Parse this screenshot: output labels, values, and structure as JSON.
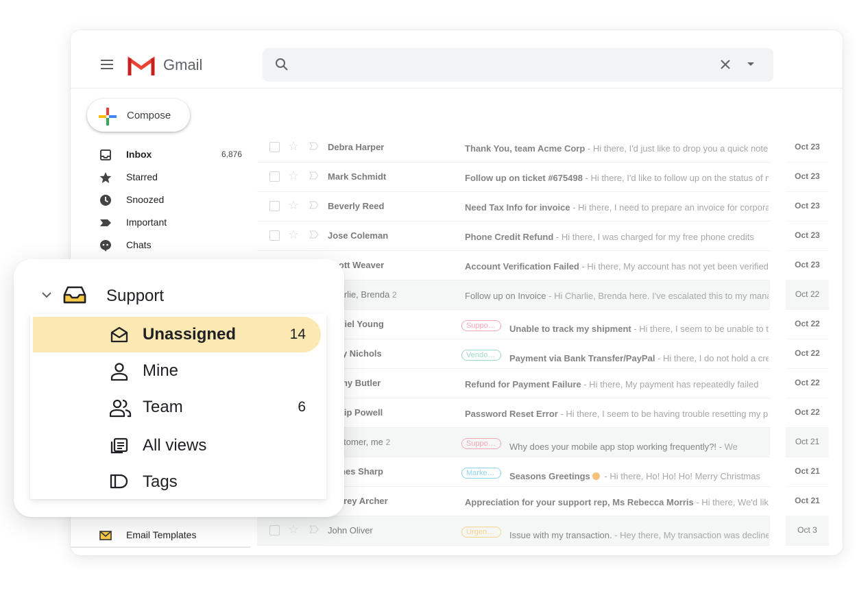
{
  "app": {
    "brand": "Gmail"
  },
  "compose": {
    "label": "Compose"
  },
  "sidebar": {
    "items": [
      {
        "label": "Inbox",
        "count": "6,876",
        "icon": "inbox-icon"
      },
      {
        "label": "Starred",
        "count": "",
        "icon": "star-icon"
      },
      {
        "label": "Snoozed",
        "count": "",
        "icon": "clock-icon"
      },
      {
        "label": "Important",
        "count": "",
        "icon": "important-icon"
      },
      {
        "label": "Chats",
        "count": "",
        "icon": "chat-icon"
      }
    ],
    "templates_label": "Email Templates"
  },
  "emails": [
    {
      "sender": "Debra Harper",
      "count": "",
      "label": "",
      "subject": "Thank You, team Acme Corp",
      "snippet": " - Hi there, I'd just like to drop you a quick note to say thanks",
      "date": "Oct 23",
      "read": false
    },
    {
      "sender": "Mark Schmidt",
      "count": "",
      "label": "",
      "subject": "Follow up on ticket #675498",
      "snippet": " - Hi there, I'd like to follow up on the status of my ticket",
      "date": "Oct 23",
      "read": false
    },
    {
      "sender": "Beverly Reed",
      "count": "",
      "label": "",
      "subject": "Need Tax Info for invoice",
      "snippet": " - Hi there, I need to prepare an invoice for corporate",
      "date": "Oct 23",
      "read": false
    },
    {
      "sender": "Jose Coleman",
      "count": "",
      "label": "",
      "subject": "Phone Credit Refund",
      "snippet": " - Hi there, I was charged for my free phone credits",
      "date": "Oct 23",
      "read": false
    },
    {
      "sender": "Scott Weaver",
      "count": "",
      "label": "",
      "subject": "Account Verification Failed",
      "snippet": " - Hi there, My account has not yet been verified",
      "date": "Oct 23",
      "read": false
    },
    {
      "sender": "Charlie, Brenda",
      "count": "2",
      "label": "",
      "subject": "Follow up on Invoice",
      "snippet": " - Hi Charlie, Brenda here. I've escalated this to my manager",
      "date": "Oct 22",
      "read": true
    },
    {
      "sender": "Daniel Young",
      "count": "",
      "label": "Support ..",
      "subject": "Unable to track my shipment",
      "snippet": " - Hi there, I seem to be unable to track",
      "date": "Oct 22",
      "read": false
    },
    {
      "sender": "Amy Nichols",
      "count": "",
      "label": "Vendor P..",
      "subject": "Payment via Bank Transfer/PayPal",
      "snippet": " - Hi there, I do not hold a credit card",
      "date": "Oct 22",
      "read": false
    },
    {
      "sender": "Kathy Butler",
      "count": "",
      "label": "",
      "subject": "Refund for Payment Failure",
      "snippet": " - Hi there, My payment has repeatedly failed",
      "date": "Oct 22",
      "read": false
    },
    {
      "sender": "Philip Powell",
      "count": "",
      "label": "",
      "subject": "Password Reset Error",
      "snippet": " - Hi there, I seem to be having trouble resetting my password",
      "date": "Oct 22",
      "read": false
    },
    {
      "sender": "Customer, me",
      "count": "2",
      "label": "Support ..",
      "subject": "Why does your mobile app stop working frequently?!",
      "snippet": " - We",
      "date": "Oct 21",
      "read": true
    },
    {
      "sender": "James Sharp",
      "count": "",
      "label": "Marketin..",
      "subject": "Seasons Greetings",
      "snippet": " - Hi there, Ho! Ho! Ho! Merry Christmas",
      "date": "Oct 21",
      "read": false,
      "emoji": true
    },
    {
      "sender": "Jeffrey Archer",
      "count": "",
      "label": "",
      "subject": "Appreciation for your support rep, Ms Rebecca Morris",
      "snippet": " - Hi there, We'd like",
      "date": "Oct 21",
      "read": false
    },
    {
      "sender": "John Oliver",
      "count": "",
      "label": "Urgent I..",
      "subject": "Issue with my transaction.",
      "snippet": " - Hey there, My transaction was declined",
      "date": "Oct 3",
      "read": true
    }
  ],
  "label_colors": {
    "Support ..": "#f3a6b5",
    "Vendor P..": "#9fd8c9",
    "Marketin..": "#8fd2ec",
    "Urgent I..": "#f6d48a"
  },
  "support": {
    "title": "Support",
    "items": [
      {
        "label": "Unassigned",
        "count": "14",
        "icon": "envelope-open-icon",
        "active": true
      },
      {
        "label": "Mine",
        "count": "",
        "icon": "person-icon",
        "active": false
      },
      {
        "label": "Team",
        "count": "6",
        "icon": "people-icon",
        "active": false
      },
      {
        "label": "All views",
        "count": "",
        "icon": "views-icon",
        "active": false
      },
      {
        "label": "Tags",
        "count": "",
        "icon": "tag-icon",
        "active": false
      }
    ]
  },
  "colors": {
    "accent": "#fce8b2",
    "gmail_red": "#ea4335"
  }
}
